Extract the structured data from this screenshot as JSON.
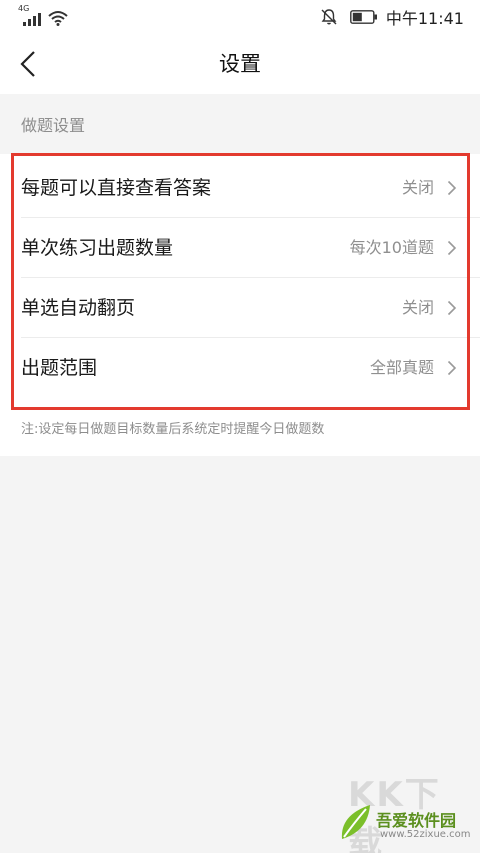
{
  "status_bar": {
    "network": "4G",
    "time": "中午11:41",
    "icons": [
      "signal-icon",
      "wifi-icon",
      "bell-muted-icon",
      "battery-icon"
    ]
  },
  "nav": {
    "back_icon": "chevron-left-icon",
    "title": "设置"
  },
  "section": {
    "header": "做题设置"
  },
  "settings": [
    {
      "label": "每题可以直接查看答案",
      "value": "关闭"
    },
    {
      "label": "单次练习出题数量",
      "value": "每次10道题"
    },
    {
      "label": "单选自动翻页",
      "value": "关闭"
    },
    {
      "label": "出题范围",
      "value": "全部真题"
    }
  ],
  "note": "注:设定每日做题目标数量后系统定时提醒今日做题数",
  "colors": {
    "highlight": "#e33a2e",
    "background": "#f4f4f4",
    "secondary_text": "#8d8d8d"
  },
  "watermark": {
    "big_text": "KK下载",
    "site_name": "吾爱软件园",
    "url": "www.52zixue.com"
  }
}
